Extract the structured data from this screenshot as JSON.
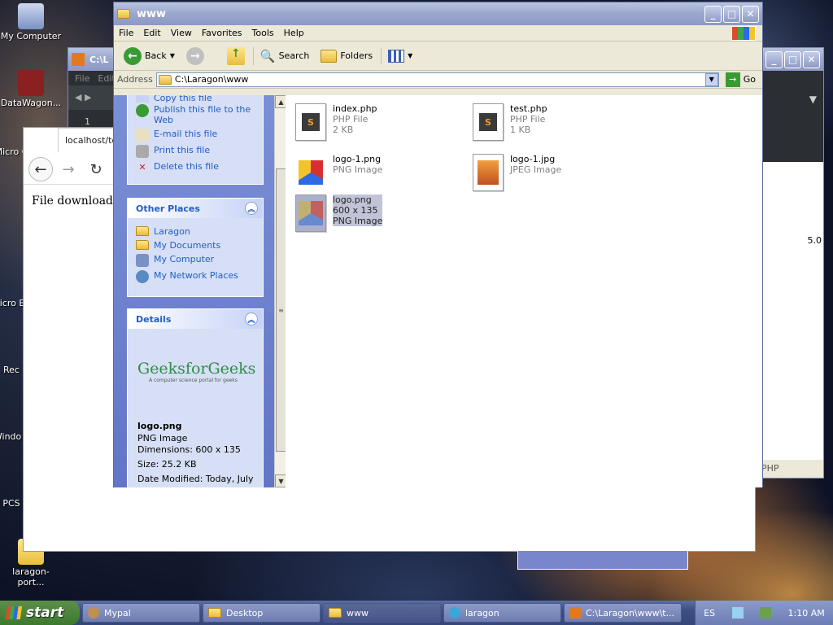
{
  "desktop": {
    "icons": [
      {
        "label": "My Computer"
      },
      {
        "label": "DataWagon..."
      },
      {
        "label": "Micro C"
      },
      {
        "label": "Micro Ba"
      },
      {
        "label": "Rec"
      },
      {
        "label": "Windo F"
      },
      {
        "label": "PCS"
      },
      {
        "label": "laragon-port..."
      }
    ]
  },
  "sublime": {
    "title": "C:\\L",
    "menu": [
      "File",
      "Edit"
    ],
    "gutter": "1",
    "status": "PHP",
    "text": "5.0"
  },
  "browser": {
    "tab": "localhost/tes",
    "body": "File downloaded"
  },
  "explorer": {
    "title": "www",
    "menu": [
      "File",
      "Edit",
      "View",
      "Favorites",
      "Tools",
      "Help"
    ],
    "toolbar": {
      "back": "Back",
      "search": "Search",
      "folders": "Folders"
    },
    "address": {
      "label": "Address",
      "value": "C:\\Laragon\\www",
      "go": "Go"
    },
    "file_tasks": [
      "Copy this file",
      "Publish this file to the Web",
      "E-mail this file",
      "Print this file",
      "Delete this file"
    ],
    "other_places": {
      "title": "Other Places",
      "items": [
        "Laragon",
        "My Documents",
        "My Computer",
        "My Network Places"
      ]
    },
    "details": {
      "title": "Details",
      "logo_text": "GeeksforGeeks",
      "logo_sub": "A computer science portal for geeks",
      "name": "logo.png",
      "type": "PNG Image",
      "dimensions": "Dimensions: 600 x 135",
      "size": "Size: 25.2 KB",
      "modified": "Date Modified: Today, July"
    },
    "files": [
      {
        "name": "index.php",
        "type": "PHP File",
        "size": "2 KB"
      },
      {
        "name": "test.php",
        "type": "PHP File",
        "size": "1 KB"
      },
      {
        "name": "logo-1.png",
        "type": "PNG Image"
      },
      {
        "name": "logo-1.jpg",
        "type": "JPEG Image"
      },
      {
        "name": "logo.png",
        "dims": "600 x 135",
        "type": "PNG Image"
      }
    ]
  },
  "taskbar": {
    "start": "start",
    "tasks": [
      "Mypal",
      "Desktop",
      "www",
      "laragon",
      "C:\\Laragon\\www\\t..."
    ],
    "lang": "ES",
    "clock": "1:10 AM"
  }
}
